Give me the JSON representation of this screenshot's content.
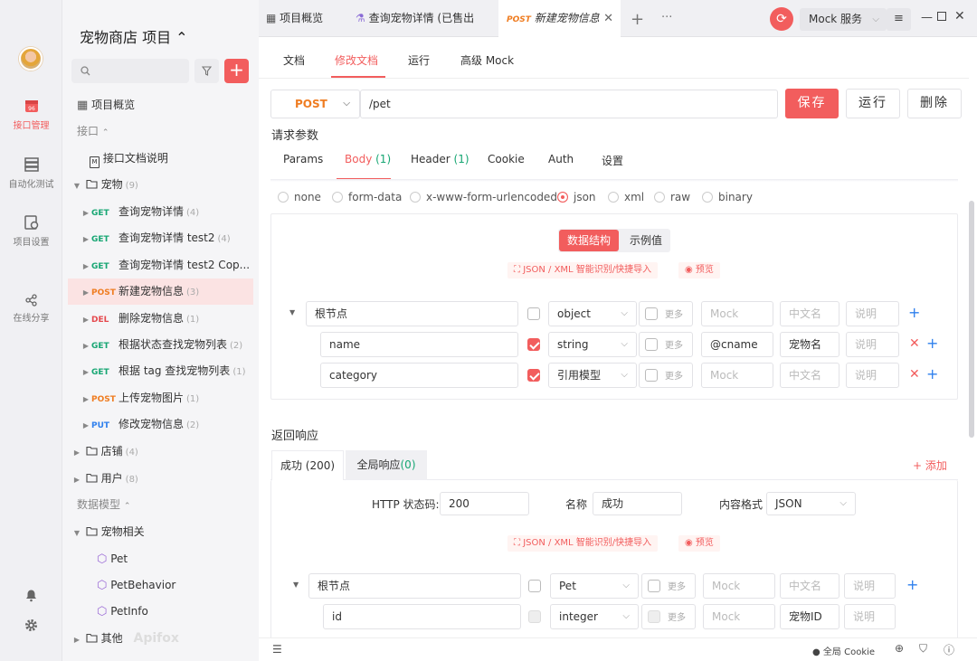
{
  "sidebar_nav": [
    {
      "label": "接口管理",
      "icon": "api-calendar-icon",
      "active": true
    },
    {
      "label": "自动化测试",
      "icon": "automation-icon",
      "active": false
    },
    {
      "label": "项目设置",
      "icon": "settings-doc-icon",
      "active": false
    },
    {
      "label": "在线分享",
      "icon": "share-icon",
      "active": false
    }
  ],
  "project": {
    "title": "宠物商店 项目 ⌃"
  },
  "tree": {
    "overview": "项目概览",
    "api_section": "接口",
    "api_doc": "接口文档说明",
    "folder_pets": {
      "label": "宠物",
      "count": "(9)"
    },
    "items": [
      {
        "method": "GET",
        "name": "查询宠物详情",
        "count": "(4)"
      },
      {
        "method": "GET",
        "name": "查询宠物详情 test2",
        "count": "(4)"
      },
      {
        "method": "GET",
        "name": "查询宠物详情 test2 Cop...",
        "count": ""
      },
      {
        "method": "POST",
        "name": "新建宠物信息",
        "count": "(3)"
      },
      {
        "method": "DEL",
        "name": "删除宠物信息",
        "count": "(1)"
      },
      {
        "method": "GET",
        "name": "根据状态查找宠物列表",
        "count": "(2)"
      },
      {
        "method": "GET",
        "name": "根据 tag 查找宠物列表",
        "count": "(1)"
      },
      {
        "method": "POST",
        "name": "上传宠物图片",
        "count": "(1)"
      },
      {
        "method": "PUT",
        "name": "修改宠物信息",
        "count": "(2)"
      }
    ],
    "folder_store": {
      "label": "店铺",
      "count": "(4)"
    },
    "folder_user": {
      "label": "用户",
      "count": "(8)"
    },
    "model_section": "数据模型",
    "model_folder": "宠物相关",
    "models": [
      "Pet",
      "PetBehavior",
      "PetInfo"
    ],
    "folder_other": "其他",
    "watermark": "Apifox"
  },
  "tabs": [
    {
      "label": "项目概览"
    },
    {
      "label": "查询宠物详情 (已售出"
    },
    {
      "method": "POST",
      "label": "新建宠物信息"
    }
  ],
  "topbar": {
    "mock": "Mock 服务"
  },
  "subtabs": [
    "文档",
    "修改文档",
    "运行",
    "高级 Mock"
  ],
  "request": {
    "method": "POST",
    "path": "/pet",
    "save": "保存",
    "run": "运行",
    "delete": "删除"
  },
  "params": {
    "title": "请求参数",
    "tabs": [
      {
        "label": "Params"
      },
      {
        "label": "Body",
        "count": "(1)"
      },
      {
        "label": "Header",
        "count": "(1)"
      },
      {
        "label": "Cookie"
      },
      {
        "label": "Auth"
      },
      {
        "label": "设置"
      }
    ],
    "body_types": [
      "none",
      "form-data",
      "x-www-form-urlencoded",
      "json",
      "xml",
      "raw",
      "binary"
    ],
    "selected_body": "json"
  },
  "schema": {
    "toggle": [
      "数据结构",
      "示例值"
    ],
    "import_label": "JSON / XML 智能识别/快捷导入",
    "preview_label": "预览",
    "more": "更多",
    "mock_ph": "Mock",
    "cn_ph": "中文名",
    "desc_ph": "说明",
    "rows": [
      {
        "name": "根节点",
        "type": "object",
        "required": false,
        "mock": "",
        "cn": ""
      },
      {
        "name": "name",
        "type": "string",
        "required": true,
        "mock": "@cname",
        "cn": "宠物名"
      },
      {
        "name": "category",
        "type": "引用模型",
        "required": true,
        "mock": "",
        "cn": ""
      }
    ]
  },
  "response": {
    "title": "返回响应",
    "tabs": [
      {
        "label": "成功 (200)"
      },
      {
        "label": "全局响应",
        "count": "(0)"
      }
    ],
    "add": "+ 添加",
    "status_label": "HTTP 状态码:",
    "status_value": "200",
    "name_label": "名称",
    "name_value": "成功",
    "format_label": "内容格式",
    "format_value": "JSON",
    "rows": [
      {
        "name": "根节点",
        "type": "Pet",
        "cn": ""
      },
      {
        "name": "id",
        "type": "integer",
        "cn": "宠物ID"
      }
    ]
  },
  "statusbar": {
    "cookie": "全局 Cookie"
  }
}
